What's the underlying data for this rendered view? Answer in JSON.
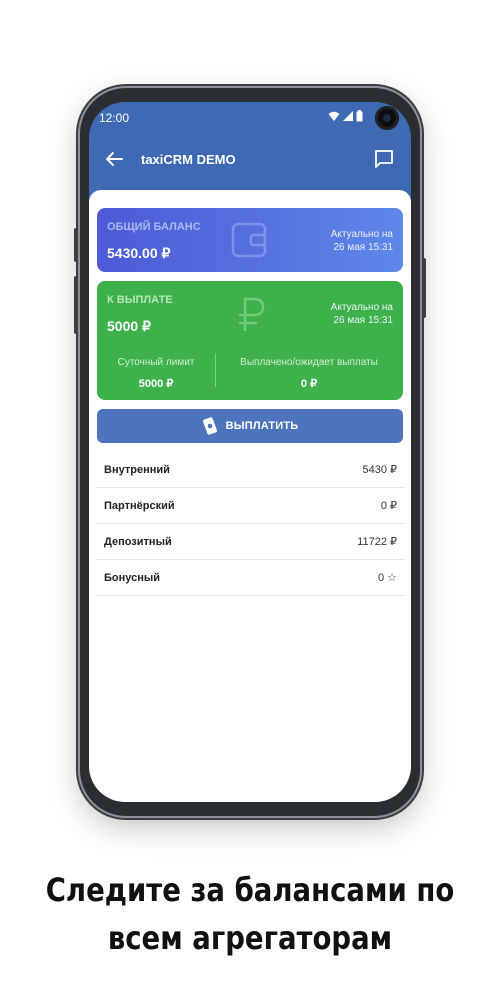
{
  "status_bar": {
    "time": "12:00"
  },
  "app_bar": {
    "title": "taxiCRM DEMO"
  },
  "balance_card": {
    "label": "ОБЩИЙ БАЛАНС",
    "amount": "5430.00 ₽",
    "updated_line1": "Актуально на",
    "updated_line2": "26 мая 15:31"
  },
  "payout_card": {
    "label": "К ВЫПЛАТЕ",
    "amount": "5000 ₽",
    "updated_line1": "Актуально на",
    "updated_line2": "26 мая 15:31",
    "daily_limit_label": "Суточный лимит",
    "daily_limit_value": "5000 ₽",
    "paid_label": "Выплачено/ожидает выплаты",
    "paid_value": "0 ₽"
  },
  "pay_button": {
    "label": "ВЫПЛАТИТЬ"
  },
  "accounts": [
    {
      "name": "Внутренний",
      "value": "5430 ₽"
    },
    {
      "name": "Партнёрский",
      "value": "0 ₽"
    },
    {
      "name": "Депозитный",
      "value": "11722 ₽"
    },
    {
      "name": "Бонусный",
      "value": "0 ☆"
    }
  ],
  "bottom_nav": [
    "cards-icon",
    "list-icon",
    "exchange-icon",
    "route-icon",
    "menu-icon"
  ],
  "colors": {
    "app_bar": "#3e6ab3",
    "balance_card_start": "#4e5ad6",
    "balance_card_end": "#5d87e8",
    "payout_card": "#3eb14a",
    "pay_button": "#4d74bd"
  },
  "caption": {
    "line1": "Следите за балансами по",
    "line2": "всем агрегаторам"
  }
}
